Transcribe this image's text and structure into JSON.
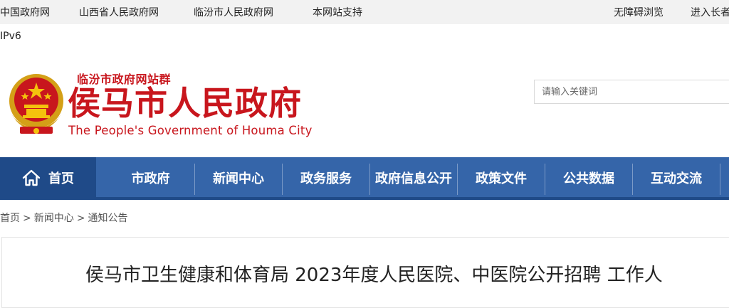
{
  "topbar": {
    "links": [
      "中国政府网",
      "山西省人民政府网",
      "临汾市人民政府网",
      "本网站支持"
    ],
    "accessibility": "无障碍浏览",
    "elder_mode": "进入长者"
  },
  "ipv6": "IPv6",
  "header": {
    "site_group": "临汾市政府网站群",
    "title": "侯马市人民政府",
    "title_en": "The People's Government of Houma City"
  },
  "search": {
    "placeholder": "请输入关键词"
  },
  "nav": {
    "home": "首页",
    "items": [
      "市政府",
      "新闻中心",
      "政务服务",
      "政府信息公开",
      "政策文件",
      "公共数据",
      "互动交流"
    ]
  },
  "breadcrumb": [
    "首页",
    "新闻中心",
    "通知公告"
  ],
  "breadcrumb_sep": ">",
  "article": {
    "title": "侯马市卫生健康和体育局 2023年度人民医院、中医院公开招聘 工作人"
  },
  "colors": {
    "brand_red": "#c8161d",
    "nav_blue": "#3565a9",
    "nav_dark": "#1f4a88"
  }
}
